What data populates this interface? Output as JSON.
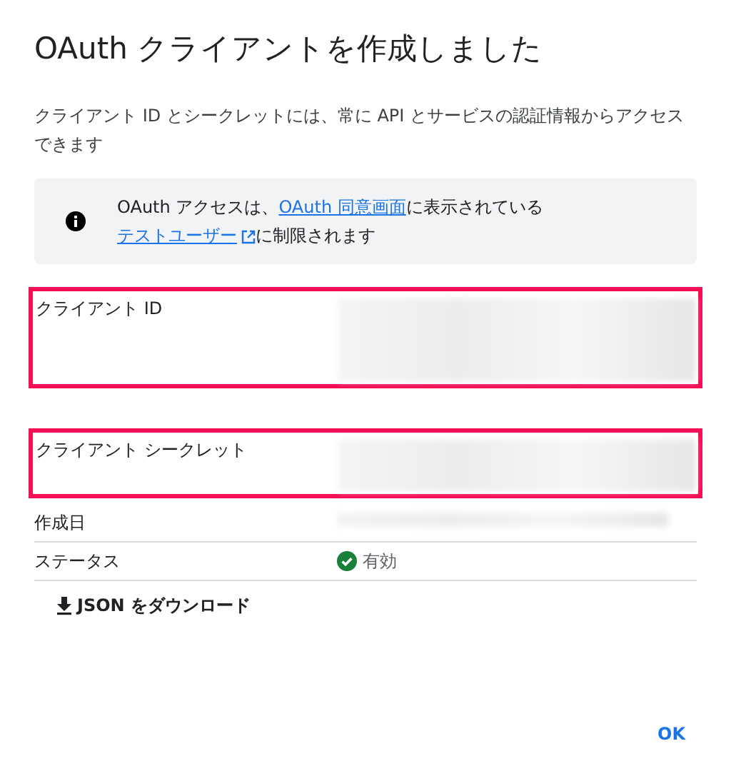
{
  "dialog": {
    "title": "OAuth クライアントを作成しました",
    "description": "クライアント ID とシークレットには、常に API とサービスの認証情報からアクセスできます",
    "notice": [
      {
        "kind": "text",
        "text": "OAuth アクセスは、"
      },
      {
        "kind": "link",
        "text": "OAuth 同意画面"
      },
      {
        "kind": "text",
        "text": "に表示されている"
      },
      {
        "kind": "external_link",
        "text": "テストユーザー"
      },
      {
        "kind": "text",
        "text": "に制限されます"
      }
    ],
    "fields": [
      {
        "label": "クライアント ID",
        "kind": "redacted",
        "highlighted": true
      },
      {
        "label": "クライアント シークレット",
        "kind": "redacted",
        "highlighted": true
      },
      {
        "label": "作成日",
        "kind": "redacted",
        "highlighted": false
      },
      {
        "label": "ステータス",
        "kind": "status",
        "value": "有効",
        "highlighted": false
      }
    ],
    "download_button": "JSON をダウンロード",
    "ok_button": "OK"
  }
}
